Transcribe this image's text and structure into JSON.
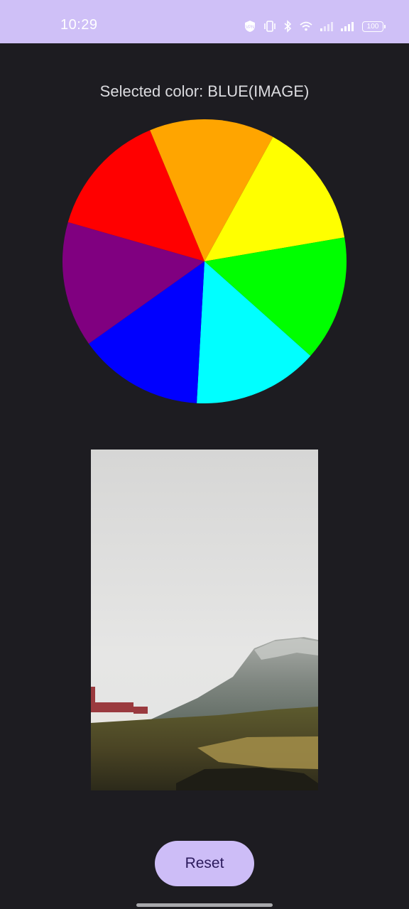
{
  "status_bar": {
    "time": "10:29",
    "battery_level": "100",
    "icons": [
      "vpn-icon",
      "vibrate-icon",
      "bluetooth-icon",
      "wifi-icon",
      "signal-icon",
      "signal-icon",
      "battery-icon"
    ]
  },
  "main": {
    "selected_text": "Selected color: BLUE(IMAGE)",
    "wheel_segments": [
      {
        "name": "red",
        "color": "#ff0000"
      },
      {
        "name": "orange",
        "color": "#ffa500"
      },
      {
        "name": "yellow",
        "color": "#ffff00"
      },
      {
        "name": "green",
        "color": "#00ff00"
      },
      {
        "name": "cyan",
        "color": "#00ffff"
      },
      {
        "name": "blue",
        "color": "#0000ff"
      },
      {
        "name": "purple",
        "color": "#800080"
      }
    ],
    "reset_label": "Reset"
  },
  "colors": {
    "status_bar": "#cfc0f7",
    "background": "#1d1c21",
    "button": "#cdbdf7",
    "button_text": "#2b1a5c"
  }
}
